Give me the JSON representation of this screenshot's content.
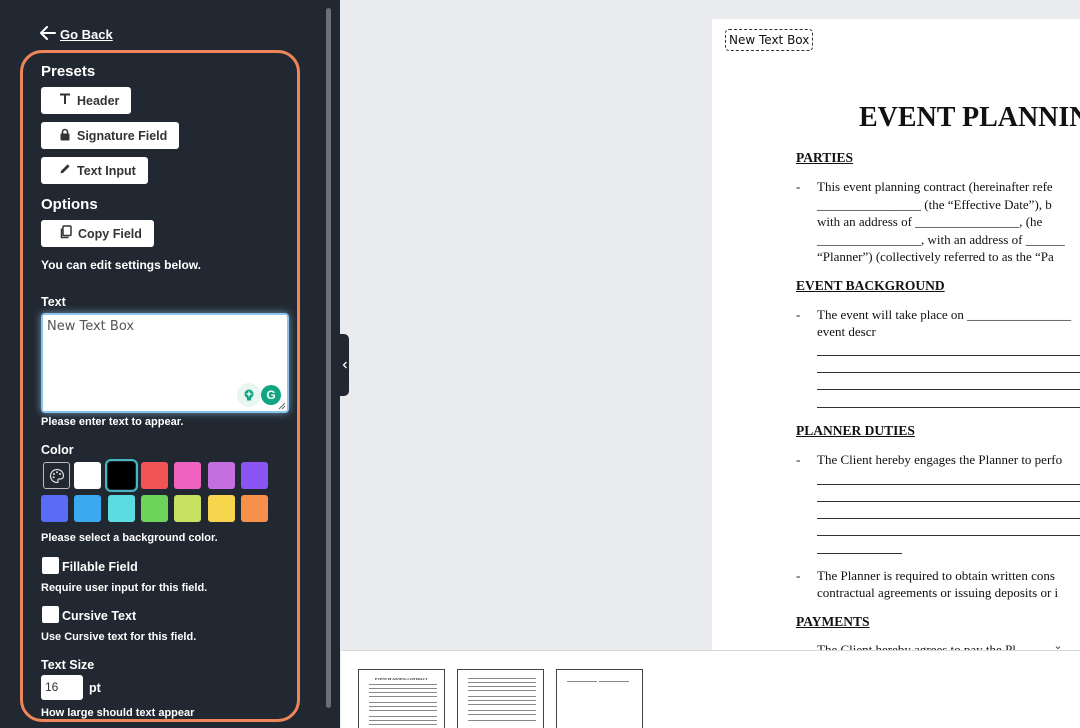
{
  "sidebar": {
    "go_back": "Go Back",
    "presets_title": "Presets",
    "presets": [
      "Header",
      "Signature Field",
      "Text Input"
    ],
    "options_title": "Options",
    "copy_field": "Copy Field",
    "edit_help": "You can edit settings below.",
    "text_label": "Text",
    "text_value": "New Text Box",
    "text_help": "Please enter text to appear.",
    "color_label": "Color",
    "colors": [
      "#ffffff",
      "#000000",
      "#f05454",
      "#f062c0",
      "#c46ee0",
      "#8b55f5",
      "#5a6cf5",
      "#3aa9f0",
      "#5adce0",
      "#6cd45a",
      "#c8e060",
      "#f7d64e",
      "#f7904a"
    ],
    "selected_color": "#000000",
    "color_help": "Please select a background color.",
    "fillable_label": "Fillable Field",
    "fillable_help": "Require user input for this field.",
    "cursive_label": "Cursive Text",
    "cursive_help": "Use Cursive text for this field.",
    "text_size_label": "Text Size",
    "text_size_value": "16",
    "text_size_unit": "pt",
    "text_size_help": "How large should text appear"
  },
  "document": {
    "new_text_box": "New Text Box",
    "title": "EVENT PLANNIN",
    "sections": {
      "parties": "PARTIES",
      "background": "EVENT BACKGROUND",
      "duties": "PLANNER DUTIES",
      "payments": "PAYMENTS"
    },
    "parties_lines": [
      "This event planning contract (hereinafter refe",
      "________________ (the “Effective Date”), b",
      "with  an  address  of  ________________,  (he",
      "________________, with an address of ______",
      "“Planner”) (collectively referred to as the “Pa"
    ],
    "background_lines": [
      "The event will take place on ________________",
      "event                                              descr"
    ],
    "duties_lines": [
      "The Client hereby engages the Planner to perfo",
      "____________"
    ],
    "duties_lines2": [
      "The Planner is required to obtain written cons",
      "contractual agreements or issuing deposits or i"
    ],
    "payments_lines": [
      "The Client hereby agrees to pay the Pl"
    ]
  },
  "thumbnails": {
    "thumb1_title": "EVENT PLANNING CONTRACT"
  }
}
